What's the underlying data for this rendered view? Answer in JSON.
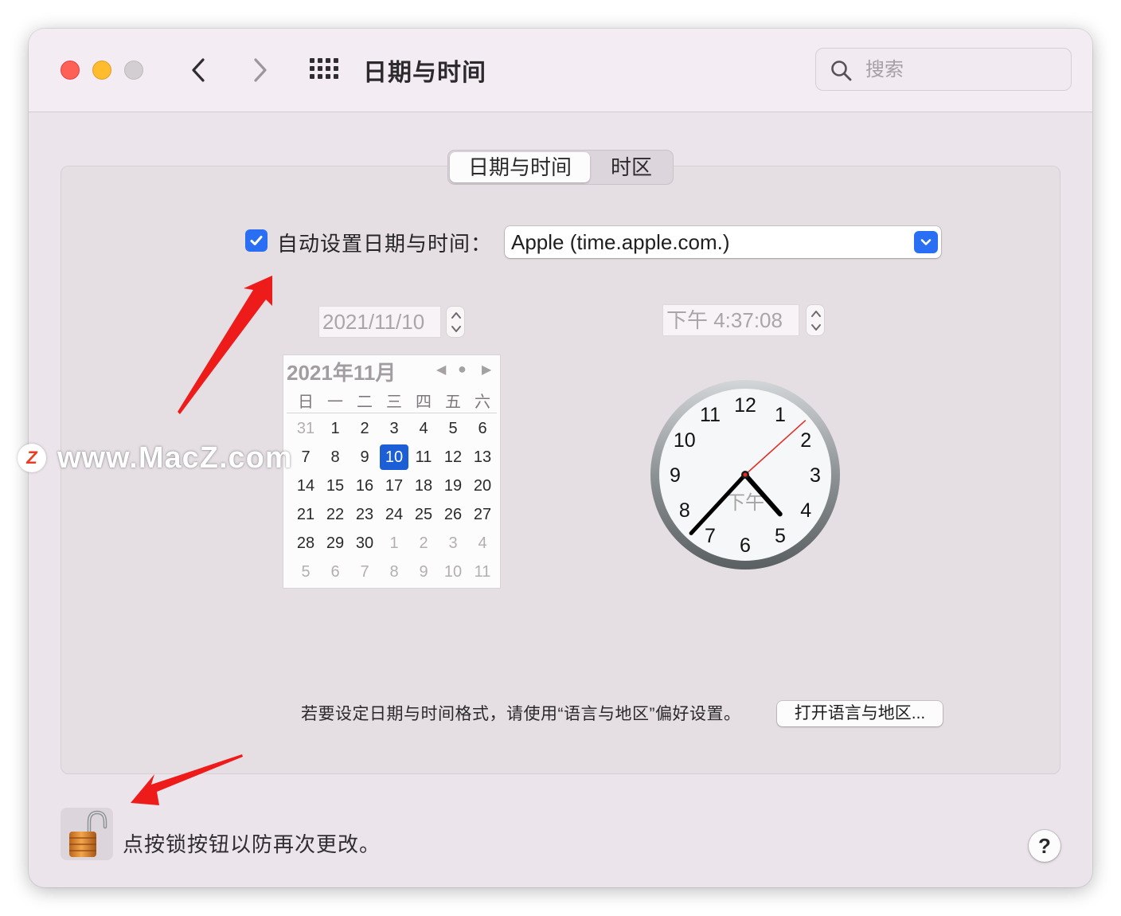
{
  "window": {
    "title": "日期与时间"
  },
  "search": {
    "placeholder": "搜索"
  },
  "tabs": [
    {
      "label": "日期与时间",
      "active": true
    },
    {
      "label": "时区",
      "active": false
    }
  ],
  "auto": {
    "checked": true,
    "label": "自动设置日期与时间：",
    "server": "Apple (time.apple.com.)"
  },
  "date_field": {
    "value": "2021/11/10"
  },
  "time_field": {
    "value": "下午  4:37:08"
  },
  "calendar": {
    "title": "2021年11月",
    "weekdays": [
      "日",
      "一",
      "二",
      "三",
      "四",
      "五",
      "六"
    ],
    "weeks": [
      [
        "31",
        "1",
        "2",
        "3",
        "4",
        "5",
        "6"
      ],
      [
        "7",
        "8",
        "9",
        "10",
        "11",
        "12",
        "13"
      ],
      [
        "14",
        "15",
        "16",
        "17",
        "18",
        "19",
        "20"
      ],
      [
        "21",
        "22",
        "23",
        "24",
        "25",
        "26",
        "27"
      ],
      [
        "28",
        "29",
        "30",
        "1",
        "2",
        "3",
        "4"
      ],
      [
        "5",
        "6",
        "7",
        "8",
        "9",
        "10",
        "11"
      ]
    ],
    "selected": "10"
  },
  "clock": {
    "numbers": [
      "12",
      "1",
      "2",
      "3",
      "4",
      "5",
      "6",
      "7",
      "8",
      "9",
      "10",
      "11"
    ],
    "period": "下午",
    "hours": 4,
    "minutes": 37,
    "seconds": 8
  },
  "hint": {
    "text": "若要设定日期与时间格式，请使用“语言与地区”偏好设置。",
    "button": "打开语言与地区..."
  },
  "lock": {
    "text": "点按锁按钮以防再次更改。"
  },
  "help": {
    "label": "?"
  },
  "watermark": {
    "logo": "Z",
    "text": "www.MacZ.com"
  },
  "colors": {
    "accent": "#2a6ef4",
    "selected_day": "#1c5ed6",
    "arrow": "#ee1b1b",
    "second_hand": "#e0302a"
  }
}
